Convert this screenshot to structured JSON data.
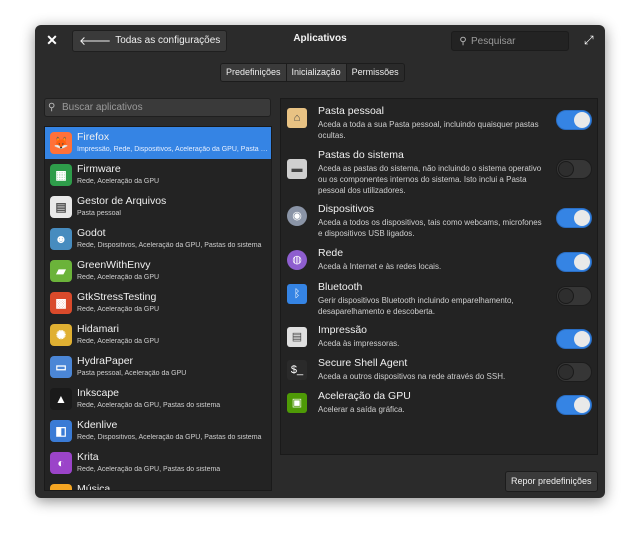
{
  "window": {
    "title": "Aplicativos",
    "back_label": "Todas as configurações",
    "search_placeholder": "Pesquisar"
  },
  "tabs": [
    {
      "label": "Predefinições",
      "active": false
    },
    {
      "label": "Inicialização",
      "active": false
    },
    {
      "label": "Permissões",
      "active": true
    }
  ],
  "apps_search": {
    "placeholder": "Buscar aplicativos"
  },
  "apps": [
    {
      "name": "Firefox",
      "desc": "Impressão, Rede, Dispositivos, Aceleração da GPU, Pasta pessoal, Acelera...",
      "icon": "firefox-icon",
      "color": "#ff7139",
      "selected": true
    },
    {
      "name": "Firmware",
      "desc": "Rede, Aceleração da GPU",
      "icon": "firmware-icon",
      "color": "#2e9d4a",
      "selected": false
    },
    {
      "name": "Gestor de Arquivos",
      "desc": "Pasta pessoal",
      "icon": "file-manager-icon",
      "color": "#e8e8e8",
      "selected": false
    },
    {
      "name": "Godot",
      "desc": "Rede, Dispositivos, Aceleração da GPU, Pastas do sistema",
      "icon": "godot-icon",
      "color": "#478cbf",
      "selected": false
    },
    {
      "name": "GreenWithEnvy",
      "desc": "Rede, Aceleração da GPU",
      "icon": "greenwithenvy-icon",
      "color": "#6bb33a",
      "selected": false
    },
    {
      "name": "GtkStressTesting",
      "desc": "Rede, Aceleração da GPU",
      "icon": "gtkstresstesting-icon",
      "color": "#d94a2b",
      "selected": false
    },
    {
      "name": "Hidamari",
      "desc": "Rede, Aceleração da GPU",
      "icon": "hidamari-icon",
      "color": "#e0b032",
      "selected": false
    },
    {
      "name": "HydraPaper",
      "desc": "Pasta pessoal, Aceleração da GPU",
      "icon": "hydrapaper-icon",
      "color": "#4b86d6",
      "selected": false
    },
    {
      "name": "Inkscape",
      "desc": "Rede, Aceleração da GPU, Pastas do sistema",
      "icon": "inkscape-icon",
      "color": "#1a1a1a",
      "selected": false
    },
    {
      "name": "Kdenlive",
      "desc": "Rede, Dispositivos, Aceleração da GPU, Pastas do sistema",
      "icon": "kdenlive-icon",
      "color": "#3a7bd5",
      "selected": false
    },
    {
      "name": "Krita",
      "desc": "Rede, Aceleração da GPU, Pastas do sistema",
      "icon": "krita-icon",
      "color": "#9b44c9",
      "selected": false
    },
    {
      "name": "Música",
      "desc": "",
      "icon": "music-icon",
      "color": "#f5a623",
      "selected": false
    }
  ],
  "permissions": [
    {
      "title": "Pasta pessoal",
      "desc": "Aceda a toda a sua Pasta pessoal, incluindo quaisquer pastas ocultas.",
      "icon": "home-folder-icon",
      "color": "#e8c283",
      "on": true
    },
    {
      "title": "Pastas do sistema",
      "desc": "Aceda as pastas do sistema, não incluindo o sistema operativo ou os componentes internos do sistema. Isto inclui a Pasta pessoal dos utilizadores.",
      "icon": "drive-icon",
      "color": "#cfcfcf",
      "on": false
    },
    {
      "title": "Dispositivos",
      "desc": "Aceda a todos os dispositivos, tais como webcams, microfones e dispositivos USB ligados.",
      "icon": "webcam-icon",
      "color": "#8a94a6",
      "on": true
    },
    {
      "title": "Rede",
      "desc": "Aceda à Internet e às redes locais.",
      "icon": "network-icon",
      "color": "#8e5ecf",
      "on": true
    },
    {
      "title": "Bluetooth",
      "desc": "Gerir dispositivos Bluetooth incluindo emparelhamento, desaparelhamento e descoberta.",
      "icon": "bluetooth-icon",
      "color": "#3584e4",
      "on": false
    },
    {
      "title": "Impressão",
      "desc": "Aceda às impressoras.",
      "icon": "printer-icon",
      "color": "#e0e0e0",
      "on": true
    },
    {
      "title": "Secure Shell Agent",
      "desc": "Aceda a outros dispositivos na rede através do SSH.",
      "icon": "terminal-icon",
      "color": "#2a2a2a",
      "on": false
    },
    {
      "title": "Aceleração da GPU",
      "desc": "Acelerar a saída gráfica.",
      "icon": "gpu-icon",
      "color": "#4e9a06",
      "on": true
    }
  ],
  "reset_label": "Repor predefinições"
}
